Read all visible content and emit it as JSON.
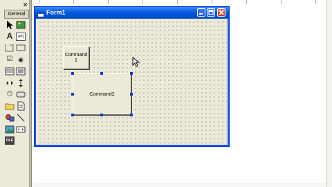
{
  "toolbox": {
    "close_glyph": "✕",
    "tab_label": "General",
    "tools": [
      {
        "name": "pointer",
        "icon": "pointer-icon"
      },
      {
        "name": "picturebox",
        "icon": "picturebox-icon"
      },
      {
        "name": "label",
        "icon": "label-icon",
        "glyph": "A"
      },
      {
        "name": "textbox",
        "icon": "textbox-icon",
        "glyph": "ab|"
      },
      {
        "name": "frame",
        "icon": "frame-icon"
      },
      {
        "name": "commandbutton",
        "icon": "commandbutton-icon"
      },
      {
        "name": "checkbox",
        "icon": "checkbox-icon",
        "glyph": "☑"
      },
      {
        "name": "optionbutton",
        "icon": "optionbutton-icon",
        "glyph": "◉"
      },
      {
        "name": "combobox",
        "icon": "combobox-icon"
      },
      {
        "name": "listbox",
        "icon": "listbox-icon"
      },
      {
        "name": "hscrollbar",
        "icon": "hscrollbar-icon"
      },
      {
        "name": "vscrollbar",
        "icon": "vscrollbar-icon"
      },
      {
        "name": "timer",
        "icon": "timer-icon",
        "glyph": "⏱"
      },
      {
        "name": "drivelistbox",
        "icon": "drivelistbox-icon"
      },
      {
        "name": "dirlistbox",
        "icon": "dirlistbox-icon"
      },
      {
        "name": "filelistbox",
        "icon": "filelistbox-icon"
      },
      {
        "name": "shape",
        "icon": "shape-icon"
      },
      {
        "name": "line",
        "icon": "line-icon"
      },
      {
        "name": "image",
        "icon": "image-icon"
      },
      {
        "name": "data",
        "icon": "data-icon"
      },
      {
        "name": "ole",
        "icon": "ole-icon",
        "glyph": "OLE"
      }
    ]
  },
  "form": {
    "title": "Form1",
    "controls": {
      "command1_label": "Command\n1",
      "command2_label": "Command2"
    }
  },
  "colors": {
    "titlebar": "#0a5ee6",
    "form_bg": "#ece9d8",
    "selection_handle": "#0a3bd6",
    "close_button": "#c5381c"
  }
}
